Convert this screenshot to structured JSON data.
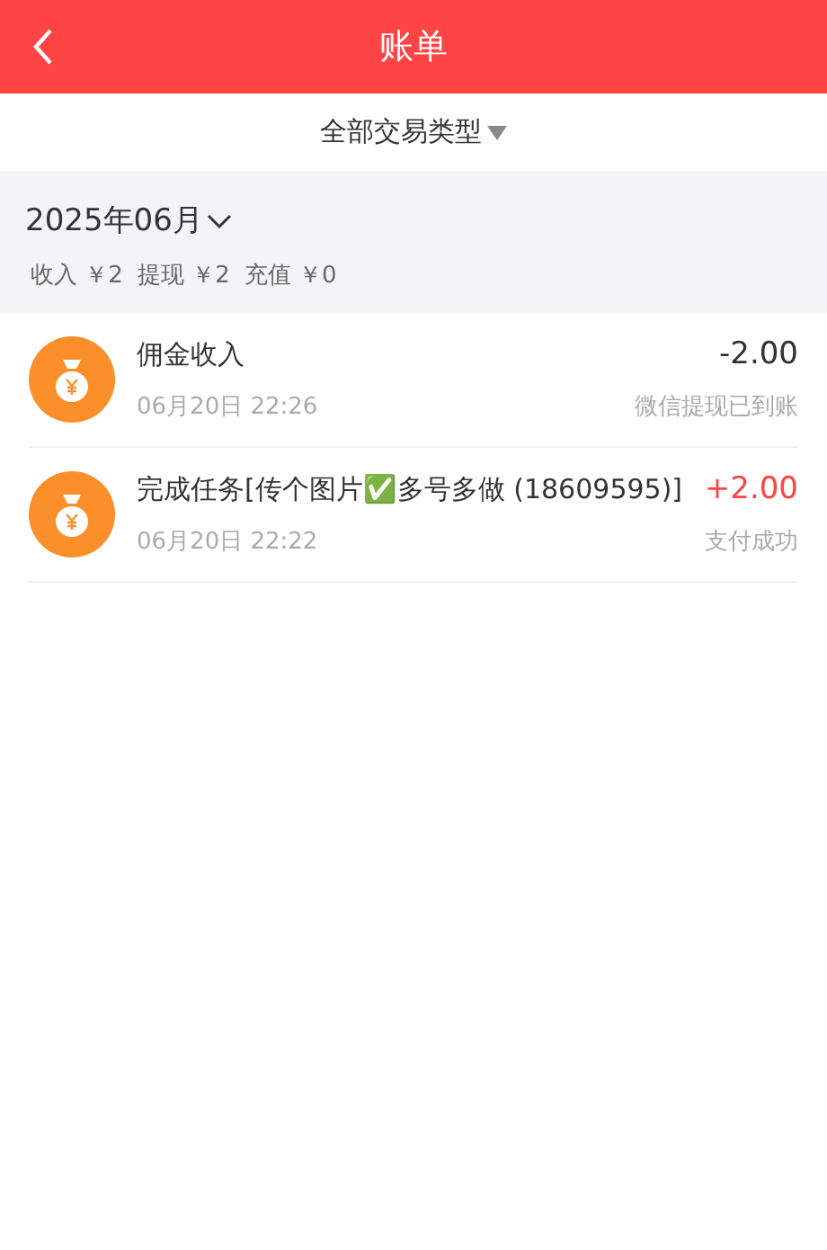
{
  "header": {
    "title": "账单"
  },
  "filter": {
    "label": "全部交易类型"
  },
  "month": {
    "label": "2025年06月",
    "summary": [
      {
        "label": "收入",
        "value": "￥2"
      },
      {
        "label": "提现",
        "value": "￥2"
      },
      {
        "label": "充值",
        "value": "￥0"
      }
    ]
  },
  "transactions": [
    {
      "title": "佣金收入",
      "time": "06月20日 22:26",
      "amount": "-2.00",
      "status": "微信提现已到账",
      "kind": "debit"
    },
    {
      "title": "完成任务[传个图片✅多号多做 (18609595)]",
      "time": "06月20日 22:22",
      "amount": "+2.00",
      "status": "支付成功",
      "kind": "credit"
    }
  ]
}
